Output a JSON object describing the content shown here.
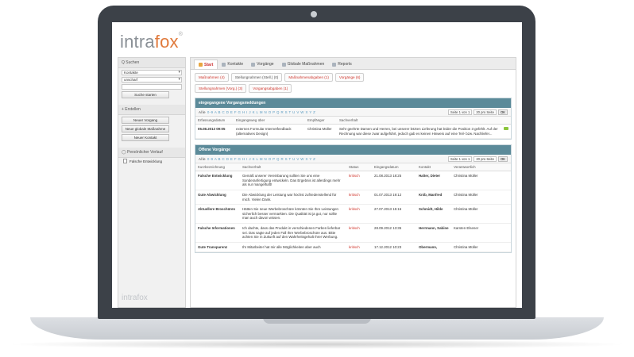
{
  "app": {
    "logo_main": "intra",
    "logo_accent": "fox",
    "logo_mark": "®",
    "footer_logo": "intrafox"
  },
  "sidebar": {
    "search_label": "Q Suchen",
    "select1": "Kontakte",
    "select2": "unscharf",
    "search_button": "Suche starten",
    "create_label": "+ Erstellen",
    "buttons": [
      "Neuer Vorgang",
      "Neue globale Maßnahme",
      "Neuer Kontakt"
    ],
    "history_label": "Persönlicher Verlauf",
    "history_item": "Falsche Entwicklung"
  },
  "tabs": [
    "Start",
    "Kontakte",
    "Vorgänge",
    "Globale Maßnahmen",
    "Reports"
  ],
  "chips_row1": [
    "Maßnahmen (4)",
    "Stellungnahmen (Stell.) (0)",
    "Maßnahmenabgaben (1)"
  ],
  "chips_row2": [
    "Vorgänge (6)",
    "Stellungnahmen (Vorg.) (3)",
    "Vorgangsabgaben (1)"
  ],
  "incoming": {
    "title": "eingegangene Vorgangsmeldungen",
    "alpha_label": "Alle",
    "letters": "0-9 A B C D E F G H I J K L M N O P Q R S T U V W X Y Z",
    "page_select": "Seite 1 von 1",
    "per_page": "20 pro Seite",
    "ok": "OK",
    "headers": [
      "Erfassungsdatum",
      "Eingangsweg über",
      "Empfänger",
      "Sachverhalt"
    ],
    "row": {
      "date": "05.08.2013 09:05",
      "channel": "externes Formular Internetfeedback (alternatives Design)",
      "recipient": "Christina Müller",
      "text": "Sehr geehrte Damen und Herren, bei unserer letzten Lieferung hat leider die Position 3 gefehlt. Auf der Rechnung war diese zwar aufgeführt, jedoch gab es keinen Hinweis auf eine Teil- bzw. Nachliefer..."
    }
  },
  "open": {
    "title": "Offene Vorgänge",
    "alpha_label": "Alle",
    "letters": "0-9 A B C D E F G H I J K L M N O P Q R S T U V W X Y Z",
    "page_select": "Seite 1 von 1",
    "per_page": "20 pro Seite",
    "ok": "OK",
    "headers": [
      "Kurzbezeichnung",
      "Sachverhalt",
      "Status",
      "Eingangsdatum",
      "Kontakt",
      "Verantwortlich"
    ],
    "rows": [
      {
        "name": "Falsche Entwicklung",
        "text": "Gemäß unserer Vereinbarung sollten Sie uns eine Sonderanfertigung entwickeln. Das Ergebnis ist allerdings mehr als nur mangelhaft!",
        "status": "kritisch",
        "date": "21.08.2013 18:25",
        "contact": "Halter, Dieter",
        "owner": "Christina Müller"
      },
      {
        "name": "Gute Abwicklung",
        "text": "Die Abwicklung der Leistung war höchst zufriedenstellend für mich. Vielen Dank.",
        "status": "kritisch",
        "date": "01.07.2013 19:12",
        "contact": "Knib, Manfred",
        "owner": "Christina Müller"
      },
      {
        "name": "Aktuellere Broschüren",
        "text": "Hätten Sie neue Werbebroschüre könnten Sie Ihre Leistungen sicherlich besser vermarkten. Die Qualität ist ja gut, nur sollte man auch davon wissen.",
        "status": "kritisch",
        "date": "27.07.2013 15:16",
        "contact": "Schmidt, Hilde",
        "owner": "Christina Müller"
      },
      {
        "name": "Falsche Informationen",
        "text": "Ich dachte, dass das Produkt in verschiedenen Farben lieferbar sei. Das sagte auf jeden Fall Ihre Werbebroschüre aus. Bitte achten Sie in Zukunft auf den Wahrheitsgehalt Ihrer Werbung.",
        "status": "kritisch",
        "date": "28.09.2012 13:35",
        "contact": "Herrmann, Sabine",
        "owner": "Karsten Elsener"
      },
      {
        "name": "Gute Transparenz",
        "text": "Ihr Mitarbeiter hat mir alle Möglichkeiten aber auch",
        "status": "kritisch",
        "date": "17.12.2012 10:23",
        "contact": "Obermann,",
        "owner": "Christina Müller"
      }
    ]
  }
}
